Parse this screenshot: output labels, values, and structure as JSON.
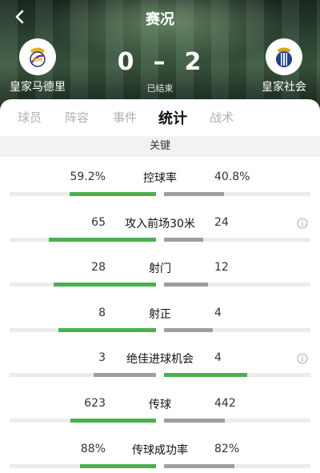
{
  "header": {
    "title": "赛况",
    "home_team": "皇家马德里",
    "away_team": "皇家社会",
    "home_score": "0",
    "away_score": "2",
    "score_separator": "–",
    "status": "已结束",
    "back_icon": "chevron-left-icon"
  },
  "tabs": [
    {
      "label": "球员"
    },
    {
      "label": "阵容"
    },
    {
      "label": "事件"
    },
    {
      "label": "统计"
    },
    {
      "label": "战术"
    }
  ],
  "active_tab": "统计",
  "section_title": "关键",
  "colors": {
    "leader": "#4caf50",
    "trailer": "#9e9e9e",
    "track": "#ececec"
  },
  "stats": [
    {
      "label": "控球率",
      "home": "59.2%",
      "away": "40.8%",
      "home_val": 59.2,
      "away_val": 40.8,
      "info": false
    },
    {
      "label": "攻入前场30米",
      "home": "65",
      "away": "24",
      "home_val": 65,
      "away_val": 24,
      "info": true
    },
    {
      "label": "射门",
      "home": "28",
      "away": "12",
      "home_val": 28,
      "away_val": 12,
      "info": false
    },
    {
      "label": "射正",
      "home": "8",
      "away": "4",
      "home_val": 8,
      "away_val": 4,
      "info": false
    },
    {
      "label": "绝佳进球机会",
      "home": "3",
      "away": "4",
      "home_val": 3,
      "away_val": 4,
      "info": true
    },
    {
      "label": "传球",
      "home": "623",
      "away": "442",
      "home_val": 623,
      "away_val": 442,
      "info": false
    },
    {
      "label": "传球成功率",
      "home": "88%",
      "away": "82%",
      "home_val": 88,
      "away_val": 82,
      "info": false
    }
  ]
}
